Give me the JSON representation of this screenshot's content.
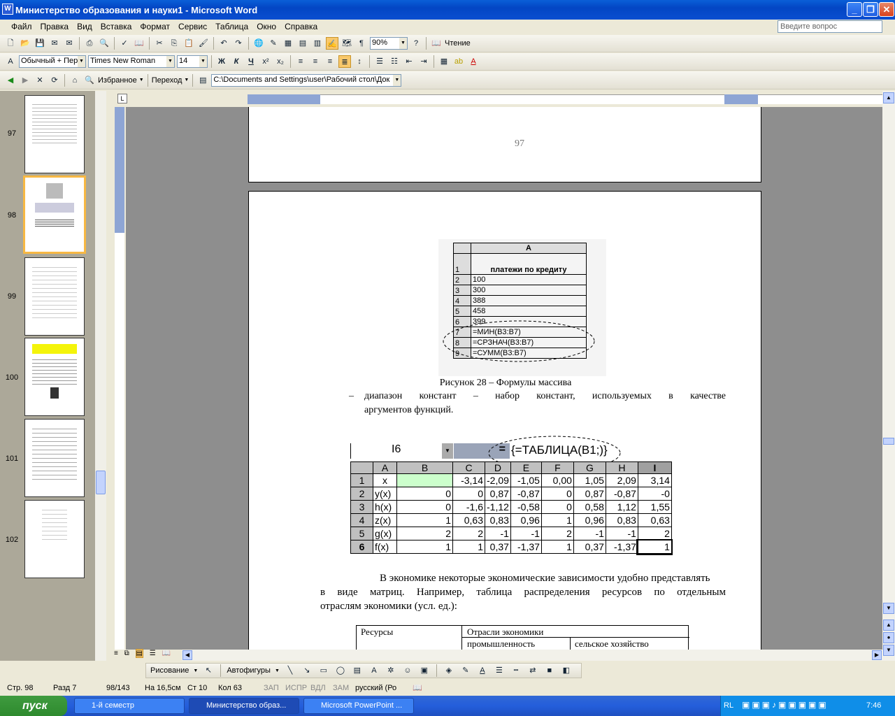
{
  "window": {
    "title": "Министерство образования и науки1 - Microsoft Word"
  },
  "menu": [
    "Файл",
    "Правка",
    "Вид",
    "Вставка",
    "Формат",
    "Сервис",
    "Таблица",
    "Окно",
    "Справка"
  ],
  "ask_placeholder": "Введите вопрос",
  "toolbar1": {
    "zoom": "90%",
    "read_label": "Чтение"
  },
  "toolbar2": {
    "style": "Обычный + Пер",
    "font": "Times New Roman",
    "size": "14",
    "bold": "Ж",
    "italic": "К",
    "underline": "Ч"
  },
  "toolbar3": {
    "favorites": "Избранное",
    "go": "Переход",
    "address": "C:\\Documents and Settings\\user\\Рабочий стол\\Док"
  },
  "thumbnails": [
    "97",
    "98",
    "99",
    "100",
    "101",
    "102"
  ],
  "page97": {
    "page_number": "97"
  },
  "fig1": {
    "col_header": "A",
    "rows": [
      [
        "1",
        "платежи по кредиту"
      ],
      [
        "2",
        "100"
      ],
      [
        "3",
        "300"
      ],
      [
        "4",
        "388"
      ],
      [
        "5",
        "458"
      ],
      [
        "6",
        "399"
      ],
      [
        "7",
        "=МИН(B3:B7)"
      ],
      [
        "8",
        "=СРЗНАЧ(B3:B7)"
      ],
      [
        "9",
        "=СУММ(B3:B7)"
      ]
    ],
    "caption": "Рисунок 28 – Формулы массива"
  },
  "bullet": {
    "dash": "–",
    "text1": "диапазон констант – набор констант, используемых в качестве",
    "text2": "аргументов функций."
  },
  "fig2": {
    "cell_ref": "I6",
    "eq": "=",
    "formula": "{=ТАБЛИЦА(B1;)}",
    "headers": [
      "",
      "A",
      "B",
      "C",
      "D",
      "E",
      "F",
      "G",
      "H",
      "I"
    ],
    "rows": [
      [
        "1",
        "x",
        "",
        "-3,14",
        "-2,09",
        "-1,05",
        "0,00",
        "1,05",
        "2,09",
        "3,14"
      ],
      [
        "2",
        "y(x)",
        "0",
        "0",
        "0,87",
        "-0,87",
        "0",
        "0,87",
        "-0,87",
        "-0"
      ],
      [
        "3",
        "h(x)",
        "0",
        "-1,6",
        "-1,12",
        "-0,58",
        "0",
        "0,58",
        "1,12",
        "1,55"
      ],
      [
        "4",
        "z(x)",
        "1",
        "0,63",
        "0,83",
        "0,96",
        "1",
        "0,96",
        "0,83",
        "0,63"
      ],
      [
        "5",
        "g(x)",
        "2",
        "2",
        "-1",
        "-1",
        "2",
        "-1",
        "-1",
        "2"
      ],
      [
        "6",
        "f(x)",
        "1",
        "1",
        "0,37",
        "-1,37",
        "1",
        "0,37",
        "-1,37",
        "1"
      ]
    ]
  },
  "para": {
    "l1": "В экономике некоторые экономические зависимости удобно представлять",
    "l2": "в виде матриц. Например, таблица распределения ресурсов по отдельным",
    "l3": "отраслям экономики (усл. ед.):"
  },
  "res_table": {
    "c1": "Ресурсы",
    "c2": "Отрасли экономики",
    "c3": "промышленность",
    "c4": "сельское хозяйство"
  },
  "drawbar": {
    "draw": "Рисование",
    "autoshapes": "Автофигуры"
  },
  "status": {
    "page": "Стр. 98",
    "section": "Разд 7",
    "pages": "98/143",
    "at": "На 16,5см",
    "line": "Ст 10",
    "col": "Кол 63",
    "rec": "ЗАП",
    "trk": "ИСПР",
    "ext": "ВДЛ",
    "ovr": "ЗАМ",
    "lang": "русский (Ро"
  },
  "taskbar": {
    "start": "пуск",
    "t1": "1-й семестр",
    "t2": "Министерство образ...",
    "t3": "Microsoft PowerPoint ...",
    "lang": "RL",
    "time": "7:46"
  }
}
